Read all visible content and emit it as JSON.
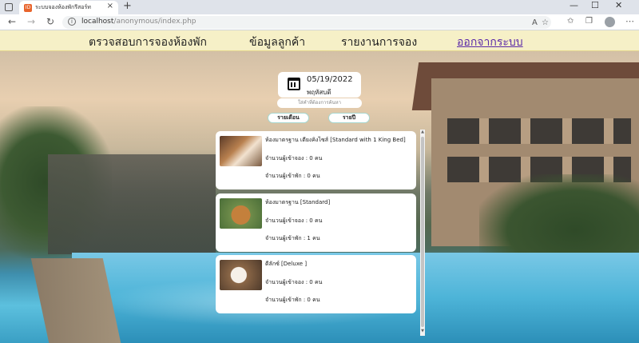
{
  "browser": {
    "tab_title": "ระบบจองห้องพักรีสอร์ท",
    "favicon_text": "ID",
    "url_host": "localhost",
    "url_path": "/anonymous/index.php",
    "icons": [
      "back-icon",
      "forward-icon",
      "reload-icon",
      "info-icon",
      "read-aloud-icon",
      "favorite-icon",
      "favorites-bar-icon",
      "collections-icon",
      "profile-icon",
      "menu-icon"
    ]
  },
  "nav": {
    "check_booking": "ตรวจสอบการจองห้องพัก",
    "customer_info": "ข้อมูลลูกค้า",
    "booking_report": "รายงานการจอง",
    "logout": "ออกจากระบบ"
  },
  "date": {
    "value": "05/19/2022",
    "day": "พฤหัสบดี"
  },
  "search": {
    "placeholder": "ใส่คำที่ต้องการค้นหา"
  },
  "buttons": {
    "monthly": "รายเดือน",
    "yearly": "รายปี"
  },
  "rooms": [
    {
      "name": "ห้องมาตรฐาน เตียงคิงไซส์ [Standard with 1 King Bed]",
      "booked": "จำนวนผู้เข้าจอง : 0 คน",
      "staying": "จำนวนผู้เข้าพัก : 0 คน"
    },
    {
      "name": "ห้องมาตรฐาน [Standard]",
      "booked": "จำนวนผู้เข้าจอง : 0 คน",
      "staying": "จำนวนผู้เข้าพัก : 1 คน"
    },
    {
      "name": "ดีลักซ์ [Deluxe ]",
      "booked": "จำนวนผู้เข้าจอง : 0 คน",
      "staying": "จำนวนผู้เข้าพัก : 0 คน"
    }
  ]
}
